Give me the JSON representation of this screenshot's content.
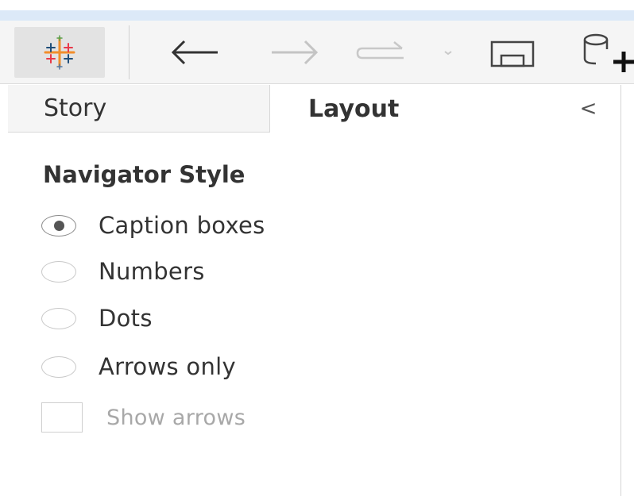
{
  "toolbar": {
    "logo_icon": "tableau-logo-icon",
    "back_icon": "arrow-left-icon",
    "forward_icon": "arrow-right-icon",
    "redo_icon": "redo-icon",
    "save_icon": "save-icon",
    "new_datasource_icon": "new-datasource-icon"
  },
  "tabs": {
    "story": "Story",
    "layout": "Layout",
    "collapse": "<"
  },
  "navigator": {
    "title": "Navigator Style",
    "options": [
      {
        "label": "Caption boxes",
        "checked": true
      },
      {
        "label": "Numbers",
        "checked": false
      },
      {
        "label": "Dots",
        "checked": false
      },
      {
        "label": "Arrows only",
        "checked": false
      }
    ],
    "show_arrows_label": "Show arrows",
    "show_arrows_checked": false
  },
  "colors": {
    "title_strip": "#dce9f8",
    "toolbar_bg": "#f5f5f5",
    "logo_blue": "#1f4e79",
    "logo_red": "#e8394a",
    "logo_orange": "#f28e2b"
  }
}
